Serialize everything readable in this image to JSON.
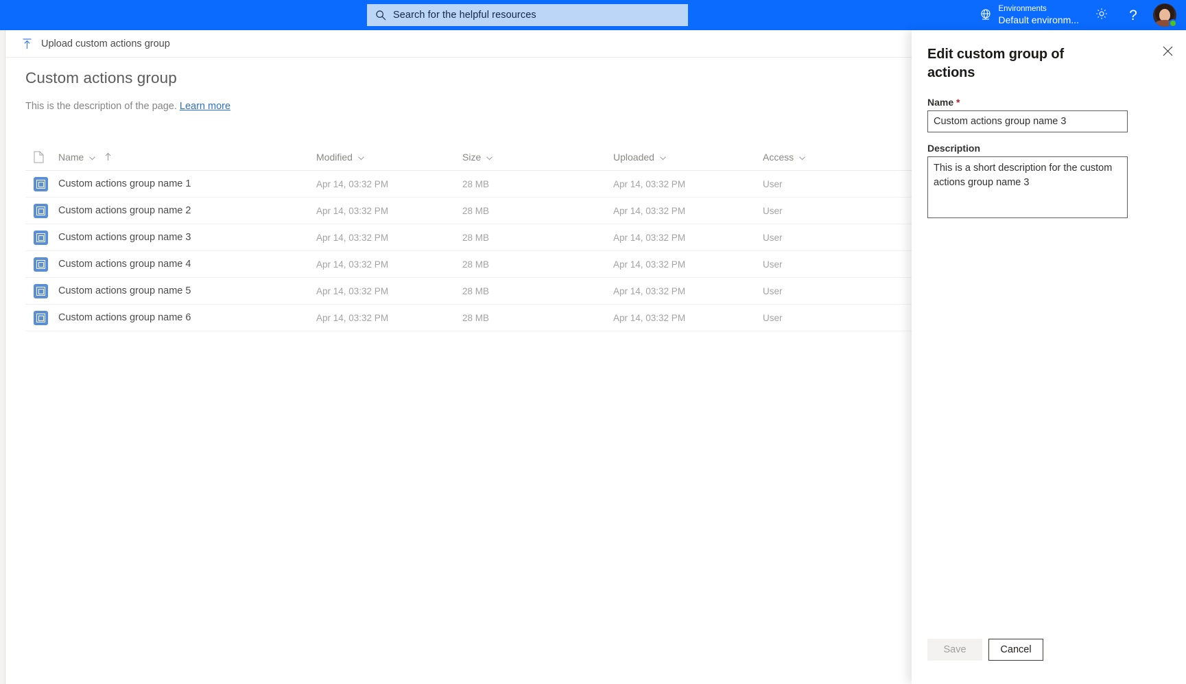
{
  "topbar": {
    "search": {
      "placeholder": "Search for the helpful resources",
      "icon": "search-icon"
    },
    "environment": {
      "label": "Environments",
      "value": "Default environm...",
      "icon": "globe-icon"
    },
    "settings_icon": "gear-icon",
    "help_icon": "help-question-icon",
    "help_glyph": "?",
    "avatar": "user-avatar",
    "accent_color": "#0B6BFF",
    "search_bg": "#BBD6F7"
  },
  "command_bar": {
    "upload_label": "Upload custom actions group",
    "upload_icon": "upload-arrow-icon"
  },
  "page": {
    "title": "Custom actions group",
    "description": "This is the description of the page.",
    "learn_more": "Learn more"
  },
  "table": {
    "columns": [
      {
        "key": "icon",
        "label": "",
        "has_chevron": false,
        "sorted": false
      },
      {
        "key": "name",
        "label": "Name",
        "has_chevron": true,
        "sorted": true
      },
      {
        "key": "modified",
        "label": "Modified",
        "has_chevron": true,
        "sorted": false
      },
      {
        "key": "size",
        "label": "Size",
        "has_chevron": true,
        "sorted": false
      },
      {
        "key": "uploaded",
        "label": "Uploaded",
        "has_chevron": true,
        "sorted": false
      },
      {
        "key": "access",
        "label": "Access",
        "has_chevron": true,
        "sorted": false
      }
    ],
    "sort_direction": "ascending",
    "rows": [
      {
        "name": "Custom actions group name 1",
        "modified": "Apr 14, 03:32 PM",
        "size": "28 MB",
        "uploaded": "Apr 14, 03:32 PM",
        "access": "User"
      },
      {
        "name": "Custom actions group name 2",
        "modified": "Apr 14, 03:32 PM",
        "size": "28 MB",
        "uploaded": "Apr 14, 03:32 PM",
        "access": "User"
      },
      {
        "name": "Custom actions group name 3",
        "modified": "Apr 14, 03:32 PM",
        "size": "28 MB",
        "uploaded": "Apr 14, 03:32 PM",
        "access": "User"
      },
      {
        "name": "Custom actions group name 4",
        "modified": "Apr 14, 03:32 PM",
        "size": "28 MB",
        "uploaded": "Apr 14, 03:32 PM",
        "access": "User"
      },
      {
        "name": "Custom actions group name 5",
        "modified": "Apr 14, 03:32 PM",
        "size": "28 MB",
        "uploaded": "Apr 14, 03:32 PM",
        "access": "User"
      },
      {
        "name": "Custom actions group name 6",
        "modified": "Apr 14, 03:32 PM",
        "size": "28 MB",
        "uploaded": "Apr 14, 03:32 PM",
        "access": "User"
      }
    ]
  },
  "panel": {
    "title": "Edit custom group of actions",
    "close_icon": "close-icon",
    "name_label": "Name",
    "name_required_mark": "*",
    "name_value": "Custom actions group name 3",
    "description_label": "Description",
    "description_value": "This is a short description for the custom actions group name 3",
    "save_label": "Save",
    "cancel_label": "Cancel",
    "save_disabled": true
  }
}
